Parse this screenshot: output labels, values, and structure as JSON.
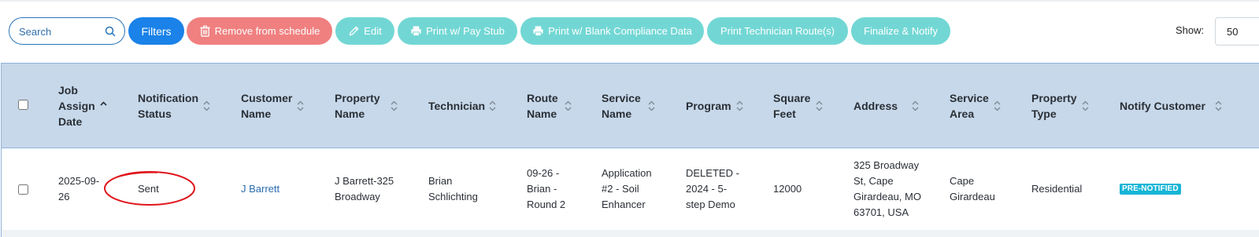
{
  "toolbar": {
    "search_placeholder": "Search",
    "filters_label": "Filters",
    "remove_label": "Remove from schedule",
    "edit_label": "Edit",
    "print_paystub_label": "Print w/ Pay Stub",
    "print_blank_label": "Print w/ Blank Compliance Data",
    "print_route_label": "Print Technician Route(s)",
    "finalize_label": "Finalize & Notify",
    "show_label": "Show:",
    "show_value": "50"
  },
  "colors": {
    "primary": "#1a82e8",
    "danger": "#f08080",
    "teal": "#72d7d4",
    "header_bg": "#c7d8ea",
    "badge": "#17b5d6",
    "annotation": "#e0151b"
  },
  "table": {
    "headers": [
      {
        "line1": "Job",
        "line2": "Assign",
        "line3": "Date"
      },
      {
        "line1": "Notification",
        "line2": "Status"
      },
      {
        "line1": "Customer",
        "line2": "Name"
      },
      {
        "line1": "Property",
        "line2": "Name"
      },
      {
        "line1": "Technician"
      },
      {
        "line1": "Route",
        "line2": "Name"
      },
      {
        "line1": "Service",
        "line2": "Name"
      },
      {
        "line1": "Program"
      },
      {
        "line1": "Square",
        "line2": "Feet"
      },
      {
        "line1": "Address"
      },
      {
        "line1": "Service",
        "line2": "Area"
      },
      {
        "line1": "Property",
        "line2": "Type"
      },
      {
        "line1": "Notify Customer"
      }
    ],
    "row": {
      "job_assign_date": [
        "2025-09-",
        "26"
      ],
      "notification_status": "Sent",
      "customer_name": "J Barrett",
      "property_name": [
        "J Barrett-325",
        "Broadway"
      ],
      "technician": [
        "Brian",
        "Schlichting"
      ],
      "route_name": [
        "09-26 -",
        "Brian -",
        "Round 2"
      ],
      "service_name": [
        "Application",
        "#2 - Soil",
        "Enhancer"
      ],
      "program": [
        "DELETED -",
        "2024 - 5-",
        "step Demo"
      ],
      "square_feet": "12000",
      "address": [
        "325 Broadway",
        "St, Cape",
        "Girardeau, MO",
        "63701, USA"
      ],
      "service_area": [
        "Cape",
        "Girardeau"
      ],
      "property_type": "Residential",
      "notify_customer": "PRE-NOTIFIED"
    }
  },
  "icons": {
    "search": "search-icon",
    "trash": "trash-icon",
    "pencil": "pencil-icon",
    "printer": "printer-icon",
    "sort": "sort-icon"
  }
}
